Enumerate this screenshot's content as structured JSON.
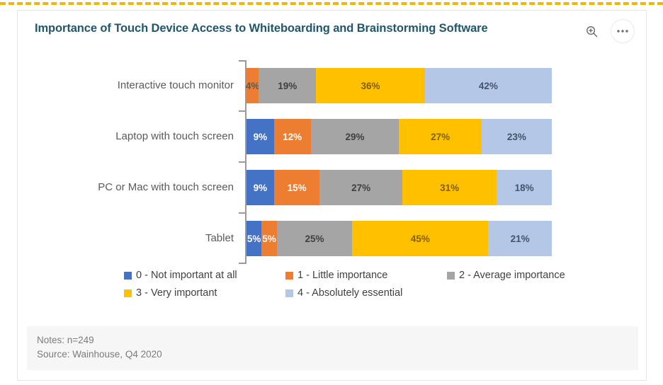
{
  "header": {
    "title": "Importance of Touch Device Access to Whiteboarding and Brainstorming Software",
    "zoom_icon": "zoom-in-magnifier-icon",
    "more_icon": "more-options-ellipsis-icon"
  },
  "notes": {
    "line1": "Notes: n=249",
    "line2": "Source: Wainhouse, Q4 2020"
  },
  "colors": {
    "s0": "#4472C4",
    "s1": "#ED7D31",
    "s2": "#A5A5A5",
    "s3": "#FFC000",
    "s4": "#B4C7E7",
    "title": "#22576B",
    "accent_dash": "#F2B705"
  },
  "chart_data": {
    "type": "bar",
    "orientation": "horizontal",
    "stacked": true,
    "stack_total": 100,
    "title": "Importance of Touch Device Access to Whiteboarding and Brainstorming Software",
    "xlabel": "",
    "ylabel": "",
    "xlim": [
      0,
      100
    ],
    "grid": false,
    "legend_position": "bottom-left",
    "value_suffix": "%",
    "categories": [
      "Interactive touch monitor",
      "Laptop with touch screen",
      "PC or Mac with touch screen",
      "Tablet"
    ],
    "series": [
      {
        "name": "0 - Not important at all",
        "color": "#4472C4",
        "values": [
          0,
          9,
          9,
          5
        ]
      },
      {
        "name": "1 - Little importance",
        "color": "#ED7D31",
        "values": [
          4,
          12,
          15,
          5
        ]
      },
      {
        "name": "2 - Average importance",
        "color": "#A5A5A5",
        "values": [
          19,
          29,
          27,
          25
        ]
      },
      {
        "name": "3 - Very important",
        "color": "#FFC000",
        "values": [
          36,
          27,
          31,
          45
        ]
      },
      {
        "name": "4 - Absolutely essential",
        "color": "#B4C7E7",
        "values": [
          42,
          23,
          18,
          21
        ]
      }
    ],
    "bar_labels": [
      [
        "",
        "4%",
        "19%",
        "36%",
        "42%"
      ],
      [
        "9%",
        "12%",
        "29%",
        "27%",
        "23%"
      ],
      [
        "9%",
        "15%",
        "27%",
        "31%",
        "18%"
      ],
      [
        "5%",
        "5%",
        "25%",
        "45%",
        "21%"
      ]
    ],
    "label_text_colors": [
      [
        "#ffffff",
        "#595959",
        "#404040",
        "#7F6000",
        "#44546A"
      ],
      [
        "#ffffff",
        "#ffffff",
        "#404040",
        "#7F6000",
        "#44546A"
      ],
      [
        "#ffffff",
        "#ffffff",
        "#404040",
        "#7F6000",
        "#44546A"
      ],
      [
        "#ffffff",
        "#ffffff",
        "#404040",
        "#7F6000",
        "#44546A"
      ]
    ]
  }
}
